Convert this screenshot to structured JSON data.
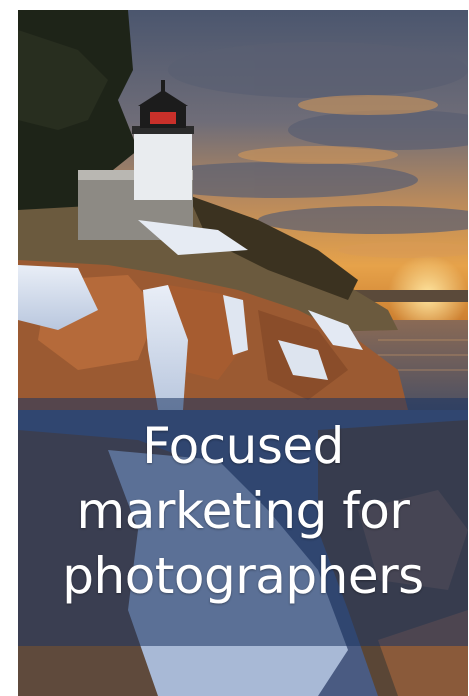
{
  "banner": {
    "headline_lines": [
      "Focused",
      "marketing for",
      "photographers"
    ],
    "colors": {
      "band_overlay": "#1c3462",
      "text": "#ffffff",
      "sky_warm": "#e6a24a",
      "sky_cool": "#4d5870"
    },
    "photo": {
      "subject": "lighthouse-on-rocky-coast-at-sunset"
    }
  }
}
